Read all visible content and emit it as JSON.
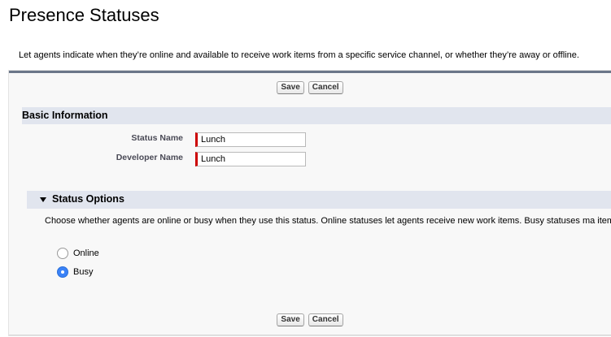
{
  "page": {
    "title": "Presence Statuses",
    "description": "Let agents indicate when they’re online and available to receive work items from a specific service channel, or whether they’re away or offline."
  },
  "buttons": {
    "save_label": "Save",
    "cancel_label": "Cancel"
  },
  "basic_info": {
    "header": "Basic Information",
    "status_name_label": "Status Name",
    "status_name_value": "Lunch",
    "developer_name_label": "Developer Name",
    "developer_name_value": "Lunch"
  },
  "status_options": {
    "header": "Status Options",
    "description": "Choose whether agents are online or busy when they use this status. Online statuses let agents receive new work items. Busy statuses ma items.",
    "options": [
      {
        "label": "Online",
        "selected": false
      },
      {
        "label": "Busy",
        "selected": true
      }
    ]
  },
  "colors": {
    "accent_radio": "#3a82f7",
    "required_marker": "#cc0000",
    "section_header_bg": "#e1e5ee",
    "panel_top_border": "#6b7689"
  }
}
